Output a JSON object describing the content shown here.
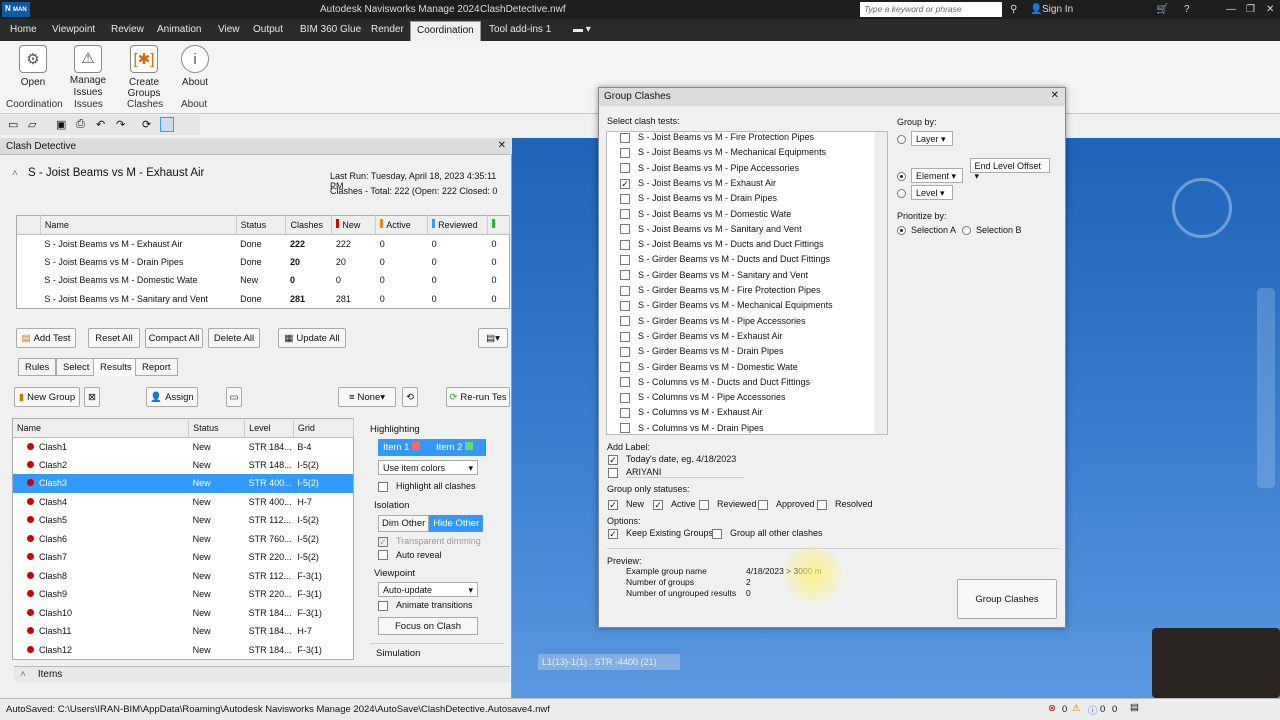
{
  "titlebar": {
    "app_badge": "N",
    "app_badge_sub": "MAN",
    "title": "Autodesk Navisworks Manage 2024",
    "file": "ClashDetective.nwf",
    "search_placeholder": "Type a keyword or phrase",
    "sign_in": "Sign In"
  },
  "ribbon_tabs": [
    "Home",
    "Viewpoint",
    "Review",
    "Animation",
    "View",
    "Output",
    "BIM 360 Glue",
    "Render",
    "Coordination",
    "Tool add-ins 1"
  ],
  "ribbon_buttons": {
    "open": "Open",
    "manage": "Manage",
    "issues": "Issues",
    "create_groups": "Create Groups",
    "about": "About"
  },
  "ribbon_groups": {
    "coordination": "Coordination",
    "issues": "Issues",
    "clashes": "Clashes",
    "about": "About"
  },
  "clash_detective": {
    "panel_title": "Clash Detective",
    "test_name": "S - Joist Beams vs M - Exhaust Air",
    "last_run": "Last Run:  Tuesday, April 18, 2023 4:35:11 PM",
    "clashes_summary": "Clashes - Total:  222  (Open:  222  Closed:  0",
    "columns": [
      "Name",
      "Status",
      "Clashes",
      "New",
      "Active",
      "Reviewed"
    ],
    "tests": [
      {
        "name": "S - Joist Beams vs M - Exhaust Air",
        "status": "Done",
        "clashes": "222",
        "new": "222",
        "active": "0",
        "reviewed": "0",
        "extra": "0"
      },
      {
        "name": "S - Joist Beams vs M - Drain Pipes",
        "status": "Done",
        "clashes": "20",
        "new": "20",
        "active": "0",
        "reviewed": "0",
        "extra": "0"
      },
      {
        "name": "S - Joist Beams vs M - Domestic Wate",
        "status": "New",
        "clashes": "0",
        "new": "0",
        "active": "0",
        "reviewed": "0",
        "extra": "0"
      },
      {
        "name": "S - Joist Beams vs M - Sanitary and Vent",
        "status": "Done",
        "clashes": "281",
        "new": "281",
        "active": "0",
        "reviewed": "0",
        "extra": "0"
      }
    ],
    "buttons": {
      "add_test": "Add Test",
      "reset_all": "Reset All",
      "compact_all": "Compact All",
      "delete_all": "Delete All",
      "update_all": "Update All"
    },
    "subtabs": [
      "Rules",
      "Select",
      "Results",
      "Report"
    ],
    "results_toolbar": {
      "new_group": "New Group",
      "assign": "Assign",
      "none": "None",
      "rerun": "Re-run Tes"
    },
    "result_columns": [
      "Name",
      "Status",
      "Level",
      "Grid"
    ],
    "results": [
      {
        "name": "Clash1",
        "status": "New",
        "level": "STR 184...",
        "grid": "B-4"
      },
      {
        "name": "Clash2",
        "status": "New",
        "level": "STR 148...",
        "grid": "I-5(2)"
      },
      {
        "name": "Clash3",
        "status": "New",
        "level": "STR 400...",
        "grid": "I-5(2)"
      },
      {
        "name": "Clash4",
        "status": "New",
        "level": "STR 400...",
        "grid": "H-7"
      },
      {
        "name": "Clash5",
        "status": "New",
        "level": "STR 112...",
        "grid": "I-5(2)"
      },
      {
        "name": "Clash6",
        "status": "New",
        "level": "STR 760...",
        "grid": "I-5(2)"
      },
      {
        "name": "Clash7",
        "status": "New",
        "level": "STR 220...",
        "grid": "I-5(2)"
      },
      {
        "name": "Clash8",
        "status": "New",
        "level": "STR 112...",
        "grid": "F-3(1)"
      },
      {
        "name": "Clash9",
        "status": "New",
        "level": "STR 220...",
        "grid": "F-3(1)"
      },
      {
        "name": "Clash10",
        "status": "New",
        "level": "STR 184...",
        "grid": "F-3(1)"
      },
      {
        "name": "Clash11",
        "status": "New",
        "level": "STR 184...",
        "grid": "H-7"
      },
      {
        "name": "Clash12",
        "status": "New",
        "level": "STR 184...",
        "grid": "F-3(1)"
      }
    ],
    "highlighting": {
      "title": "Highlighting",
      "item1": "Item 1",
      "item2": "Item 2",
      "use_colors": "Use item colors",
      "highlight_all": "Highlight all clashes"
    },
    "isolation": {
      "title": "Isolation",
      "dim_other": "Dim Other",
      "hide_other": "Hide Other",
      "transparent": "Transparent dimming",
      "auto_reveal": "Auto reveal"
    },
    "viewpoint": {
      "title": "Viewpoint",
      "auto_update": "Auto-update",
      "animate": "Animate transitions",
      "focus": "Focus on Clash"
    },
    "simulation": "Simulation",
    "items": "Items"
  },
  "dialog": {
    "title": "Group Clashes",
    "select_label": "Select clash tests:",
    "tests": [
      {
        "name": "S - Joist Beams vs M - Fire Protection Pipes",
        "checked": false
      },
      {
        "name": "S - Joist Beams vs M - Mechanical Equipments",
        "checked": false
      },
      {
        "name": "S - Joist Beams vs M - Pipe Accessories",
        "checked": false
      },
      {
        "name": "S - Joist Beams vs M - Exhaust Air",
        "checked": true
      },
      {
        "name": "S - Joist Beams vs M - Drain Pipes",
        "checked": false
      },
      {
        "name": "S - Joist Beams vs M - Domestic Wate",
        "checked": false
      },
      {
        "name": "S - Joist Beams vs M - Sanitary and Vent",
        "checked": false
      },
      {
        "name": "S - Joist Beams vs M - Ducts and Duct Fittings",
        "checked": false
      },
      {
        "name": "S - Girder Beams vs M - Ducts and Duct Fittings",
        "checked": false
      },
      {
        "name": "S - Girder Beams vs M - Sanitary and Vent",
        "checked": false
      },
      {
        "name": "S - Girder Beams vs M - Fire Protection Pipes",
        "checked": false
      },
      {
        "name": "S - Girder Beams vs M - Mechanical Equipments",
        "checked": false
      },
      {
        "name": "S - Girder Beams vs M - Pipe Accessories",
        "checked": false
      },
      {
        "name": "S - Girder Beams vs M - Exhaust Air",
        "checked": false
      },
      {
        "name": "S - Girder Beams vs M - Drain Pipes",
        "checked": false
      },
      {
        "name": "S - Girder Beams vs M - Domestic Wate",
        "checked": false
      },
      {
        "name": "S - Columns vs M - Ducts and Duct Fittings",
        "checked": false
      },
      {
        "name": "S - Columns vs M - Pipe Accessories",
        "checked": false
      },
      {
        "name": "S - Columns vs M - Exhaust Air",
        "checked": false
      },
      {
        "name": "S - Columns vs M - Drain Pipes",
        "checked": false
      }
    ],
    "group_by": "Group by:",
    "layer": "Layer",
    "element": "Element",
    "end_level_offset": "End Level Offset",
    "level": "Level",
    "prioritize": "Prioritize by:",
    "sel_a": "Selection A",
    "sel_b": "Selection B",
    "add_label": "Add Label:",
    "todays_date": "Today's date, eg. 4/18/2023",
    "label_value": "ARIYANI",
    "group_statuses": "Group only statuses:",
    "statuses": [
      {
        "name": "New",
        "checked": true
      },
      {
        "name": "Active",
        "checked": true
      },
      {
        "name": "Reviewed",
        "checked": false
      },
      {
        "name": "Approved",
        "checked": false
      },
      {
        "name": "Resolved",
        "checked": false
      }
    ],
    "options": "Options:",
    "keep_existing": "Keep Existing Groups",
    "group_other": "Group all other clashes",
    "preview": "Preview:",
    "example_label": "Example group name",
    "example_value": "4/18/2023 > 3000 m",
    "groups_label": "Number of groups",
    "groups_value": "2",
    "ungrouped_label": "Number of ungrouped results",
    "ungrouped_value": "0",
    "group_button": "Group Clashes"
  },
  "viewport": {
    "tooltip": "L1(13)-1(1) : STR -4400 (21)"
  },
  "statusbar": {
    "autosave": "AutoSaved: C:\\Users\\IRAN-BIM\\AppData\\Roaming\\Autodesk Navisworks Manage 2024\\AutoSave\\ClashDetective.Autosave4.nwf",
    "c1": "0",
    "c2": "0",
    "c3": "0"
  }
}
